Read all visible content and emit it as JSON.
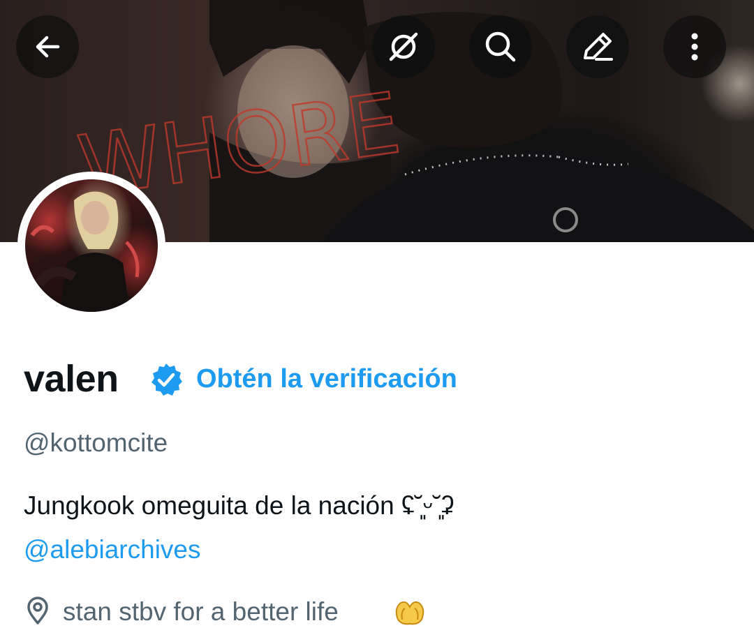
{
  "header": {
    "back_icon": "arrow-left-icon",
    "actions": [
      "grok-icon",
      "search-icon",
      "edit-pencil-icon",
      "more-vertical-icon"
    ],
    "banner_scrawl": "WHORE"
  },
  "profile": {
    "display_name": "valen",
    "verified_badge": "verified-badge-icon",
    "get_verified_label": "Obtén la verificación",
    "handle": "@kottomcite",
    "bio_line": "Jungkook omeguita de la nación ʢ˘͈ᵕ˘͈ʡ",
    "bio_mention": "@alebiarchives",
    "location_icon": "location-pin-icon",
    "location_text": "stan stbv for a better life",
    "location_emoji": "heart-hands-icon"
  },
  "colors": {
    "accent": "#1d9bf0",
    "text_primary": "#0f1419",
    "text_secondary": "#536471",
    "button_overlay": "#0f0f0f"
  }
}
